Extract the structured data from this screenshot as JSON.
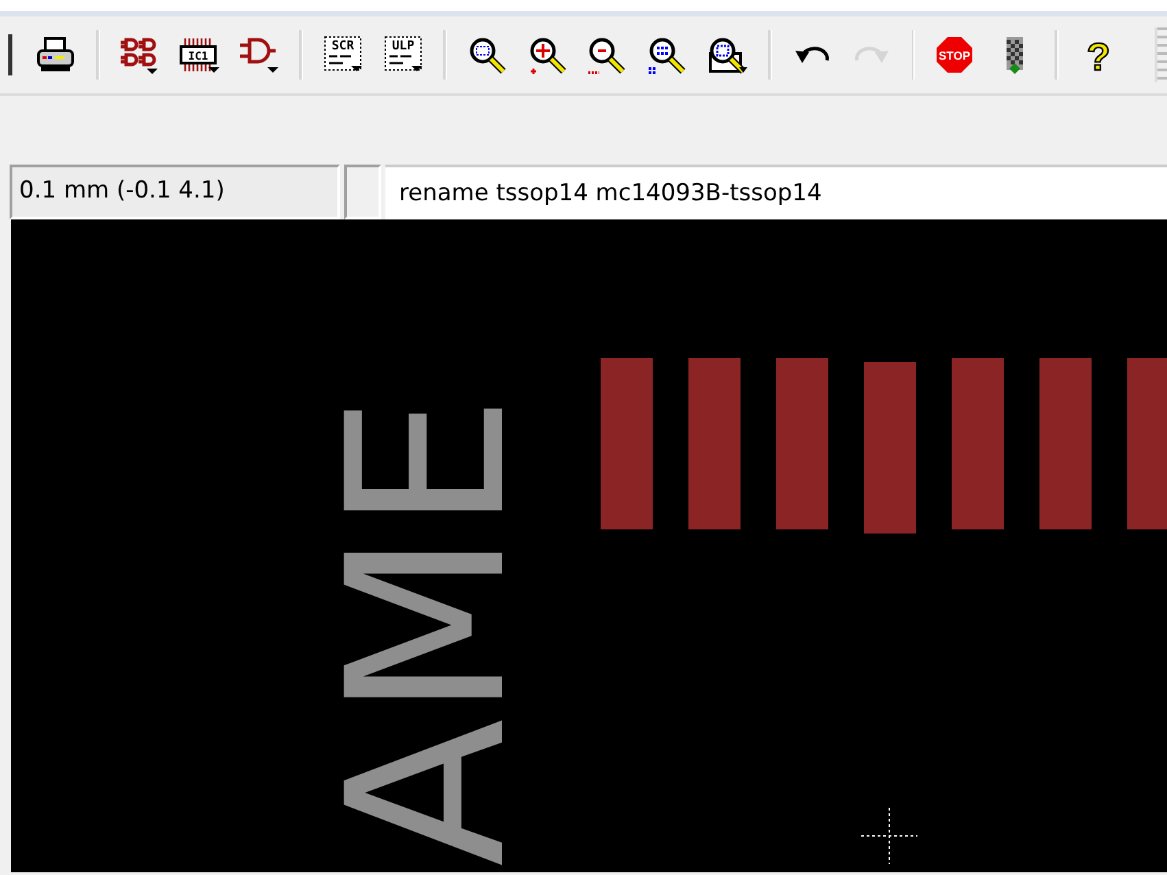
{
  "toolbar": {
    "groups": [
      [
        {
          "kind": "print",
          "disabled": false
        }
      ],
      [
        {
          "kind": "symbols",
          "disabled": false
        },
        {
          "kind": "chip",
          "text": "IC1",
          "disabled": false
        },
        {
          "kind": "gate",
          "disabled": false
        }
      ],
      [
        {
          "kind": "script",
          "text": "SCR",
          "disabled": false
        },
        {
          "kind": "script",
          "text": "ULP",
          "disabled": false
        }
      ],
      [
        {
          "kind": "zoom-fit",
          "disabled": false
        },
        {
          "kind": "zoom-in",
          "disabled": false
        },
        {
          "kind": "zoom-out",
          "disabled": false
        },
        {
          "kind": "redraw",
          "disabled": false
        },
        {
          "kind": "zoom-select",
          "disabled": false
        }
      ],
      [
        {
          "kind": "undo",
          "disabled": false
        },
        {
          "kind": "redo",
          "disabled": true
        }
      ],
      [
        {
          "kind": "stop",
          "text": "STOP",
          "disabled": false
        },
        {
          "kind": "go",
          "disabled": false
        }
      ],
      [
        {
          "kind": "help",
          "text": "?",
          "disabled": false
        }
      ]
    ]
  },
  "coordinates": "0.1 mm (-0.1 4.1)",
  "command": {
    "value": "rename tssop14 mc14093B-tssop14"
  },
  "canvas": {
    "label": "AME"
  }
}
